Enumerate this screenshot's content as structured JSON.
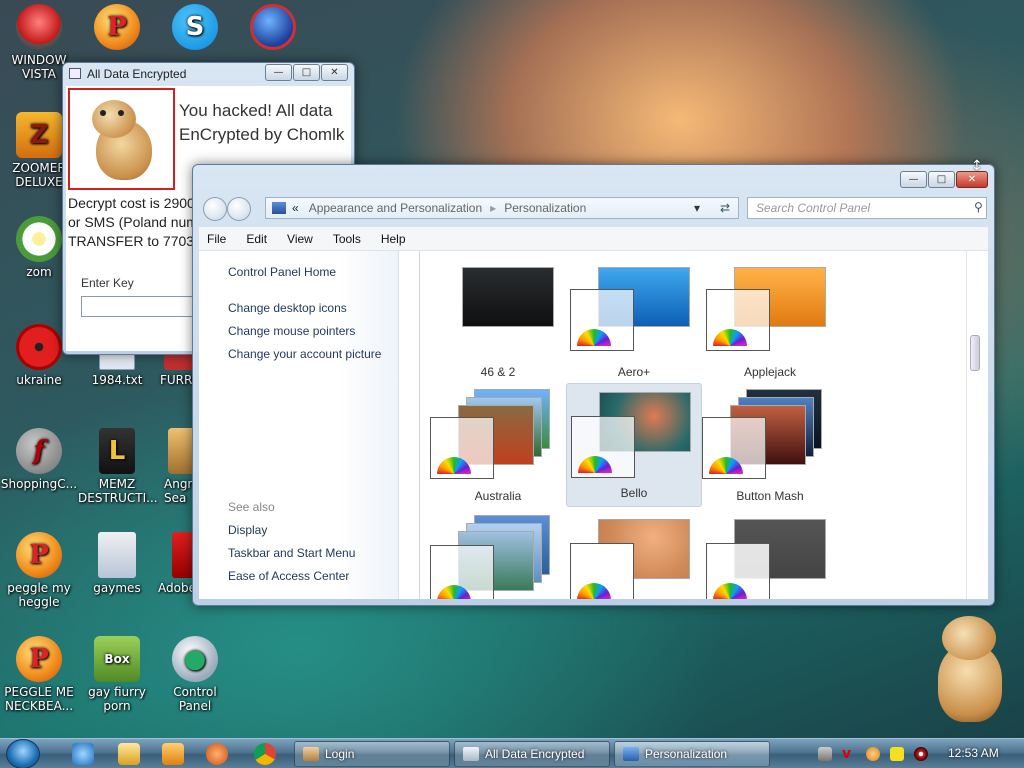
{
  "desktop": {
    "icons": [
      {
        "label": "WINDOWS VISTA",
        "display": "WINDOW\nVISTA",
        "icon": "vista-disc-icon"
      },
      {
        "label": "",
        "icon": "peggle-icon"
      },
      {
        "label": "",
        "icon": "skype-icon"
      },
      {
        "label": "",
        "icon": "globe-icon"
      },
      {
        "label": "ZOOMER DELUXE",
        "display": "ZOOMER\nDELUXE",
        "icon": "zoomer-icon"
      },
      {
        "label": "zom",
        "icon": "daisy-icon"
      },
      {
        "label": "ukraine",
        "icon": "radiation-icon"
      },
      {
        "label": "1984.txt",
        "icon": "text-file-icon"
      },
      {
        "label": "FURRY",
        "display": "FURRY",
        "icon": "furry-icon"
      },
      {
        "label": "ShoppingC...",
        "icon": "flash-icon"
      },
      {
        "label": "MEMZ DESTRUCTI...",
        "display": "MEMZ\nDESTRUCTI...",
        "icon": "memz-icon"
      },
      {
        "label": "Angry Sea",
        "display": "Angr\nSea",
        "icon": "angry-icon"
      },
      {
        "label": "peggle my heggle",
        "display": "peggle my\nheggle",
        "icon": "peggle-icon"
      },
      {
        "label": "gaymes",
        "icon": "folder-icon"
      },
      {
        "label": "Adobe",
        "display": "Adobe",
        "icon": "adobe-icon"
      },
      {
        "label": "PEGGLE ME NECKBEA...",
        "display": "PEGGLE ME\nNECKBEA...",
        "icon": "peggle-icon"
      },
      {
        "label": "gay fiurry porn",
        "display": "gay fiurry\nporn",
        "icon": "box-icon"
      },
      {
        "label": "Control Panel",
        "icon": "control-panel-icon"
      }
    ]
  },
  "ransom_window": {
    "title": "All Data Encrypted",
    "headline": "You hacked! All data\nEnCrypted by Chomlk",
    "body": "Decrypt cost is 2900\nor SMS (Poland num\nTRANSFER to 77038",
    "key_label": "Enter Key",
    "key_value": ""
  },
  "control_panel": {
    "breadcrumb": {
      "root": "«",
      "items": [
        "Appearance and Personalization",
        "Personalization"
      ]
    },
    "search_placeholder": "Search Control Panel",
    "menu": [
      "File",
      "Edit",
      "View",
      "Tools",
      "Help"
    ],
    "left_links": [
      "Control Panel Home",
      "Change desktop icons",
      "Change mouse pointers",
      "Change your account picture"
    ],
    "see_also_label": "See also",
    "see_also_links": [
      "Display",
      "Taskbar and Start Menu",
      "Ease of Access Center"
    ],
    "themes": [
      {
        "name": "46 & 2",
        "selected": false
      },
      {
        "name": "Aero+",
        "selected": false
      },
      {
        "name": "Applejack",
        "selected": false
      },
      {
        "name": "Australia",
        "selected": false
      },
      {
        "name": "Bello",
        "selected": true
      },
      {
        "name": "Button Mash",
        "selected": false
      },
      {
        "name": "",
        "selected": false
      },
      {
        "name": "",
        "selected": false
      },
      {
        "name": "",
        "selected": false
      }
    ]
  },
  "taskbar": {
    "tasks": [
      {
        "label": "Login",
        "active": false
      },
      {
        "label": "All Data Encrypted",
        "active": false
      },
      {
        "label": "Personalization",
        "active": true
      }
    ],
    "clock": "12:53 AM"
  },
  "colors": {
    "ransom_border": "#d21f1f",
    "link": "#1e395b",
    "accent": "#1c6fb5"
  }
}
